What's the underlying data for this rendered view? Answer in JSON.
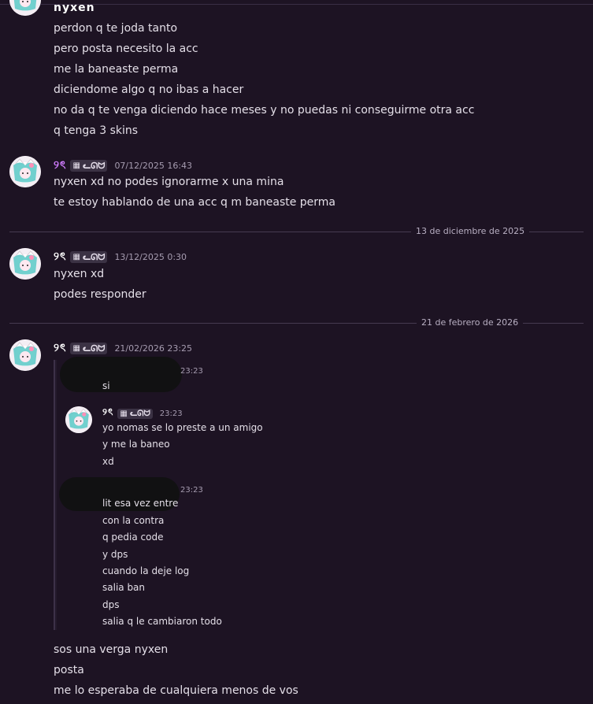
{
  "messages": {
    "first_block": {
      "author": "nyxen",
      "lines": [
        "perdon q te joda tanto",
        "pero posta necesito la acc",
        "me la baneaste perma",
        "diciendome algo q no ibas a hacer",
        "no da q te venga diciendo hace meses y no puedas ni conseguirme otra acc",
        "q tenga 3 skins"
      ]
    },
    "block_2": {
      "author": "୨ৎ",
      "tag_icon": "cat-icon",
      "tag_label": "ᓚᘏᗢ",
      "timestamp": "07/12/2025 16:43",
      "lines": [
        "nyxen xd no podes ignorarme x una mina",
        "te estoy hablando de una acc q  m baneaste perma"
      ]
    },
    "divider_1": "13 de diciembre de 2025",
    "block_3": {
      "author": "୨ৎ",
      "tag_label": "ᓚᘏᗢ",
      "timestamp": "13/12/2025 0:30",
      "lines": [
        "nyxen xd",
        "podes responder"
      ]
    },
    "divider_2": "21 de febrero de 2026",
    "block_4": {
      "author": "୨ৎ",
      "tag_label": "ᓚᘏᗢ",
      "timestamp": "21/02/2026 23:25",
      "forwarded": {
        "first": {
          "timestamp": "23:23",
          "lines": [
            "si"
          ]
        },
        "second": {
          "author": "୨ৎ",
          "tag_label": "ᓚᘏᗢ",
          "timestamp": "23:23",
          "lines": [
            "yo nomas se lo preste a un amigo",
            "y me la baneo",
            "xd"
          ]
        },
        "third": {
          "timestamp": "23:23",
          "lines": [
            "lit esa vez entre",
            "con la contra",
            "q pedia code",
            "y dps",
            "cuando la deje log",
            "salia ban",
            "dps",
            "salia q le cambiaron todo"
          ]
        }
      },
      "after_lines": [
        "sos una verga nyxen",
        "posta",
        "me lo esperaba de cualquiera menos de vos"
      ]
    }
  },
  "colors": {
    "background": "#1d1323",
    "text": "#e4dfe8",
    "accent_username": "#d17cff",
    "timestamp": "#a69cb0",
    "divider": "#463a50"
  }
}
